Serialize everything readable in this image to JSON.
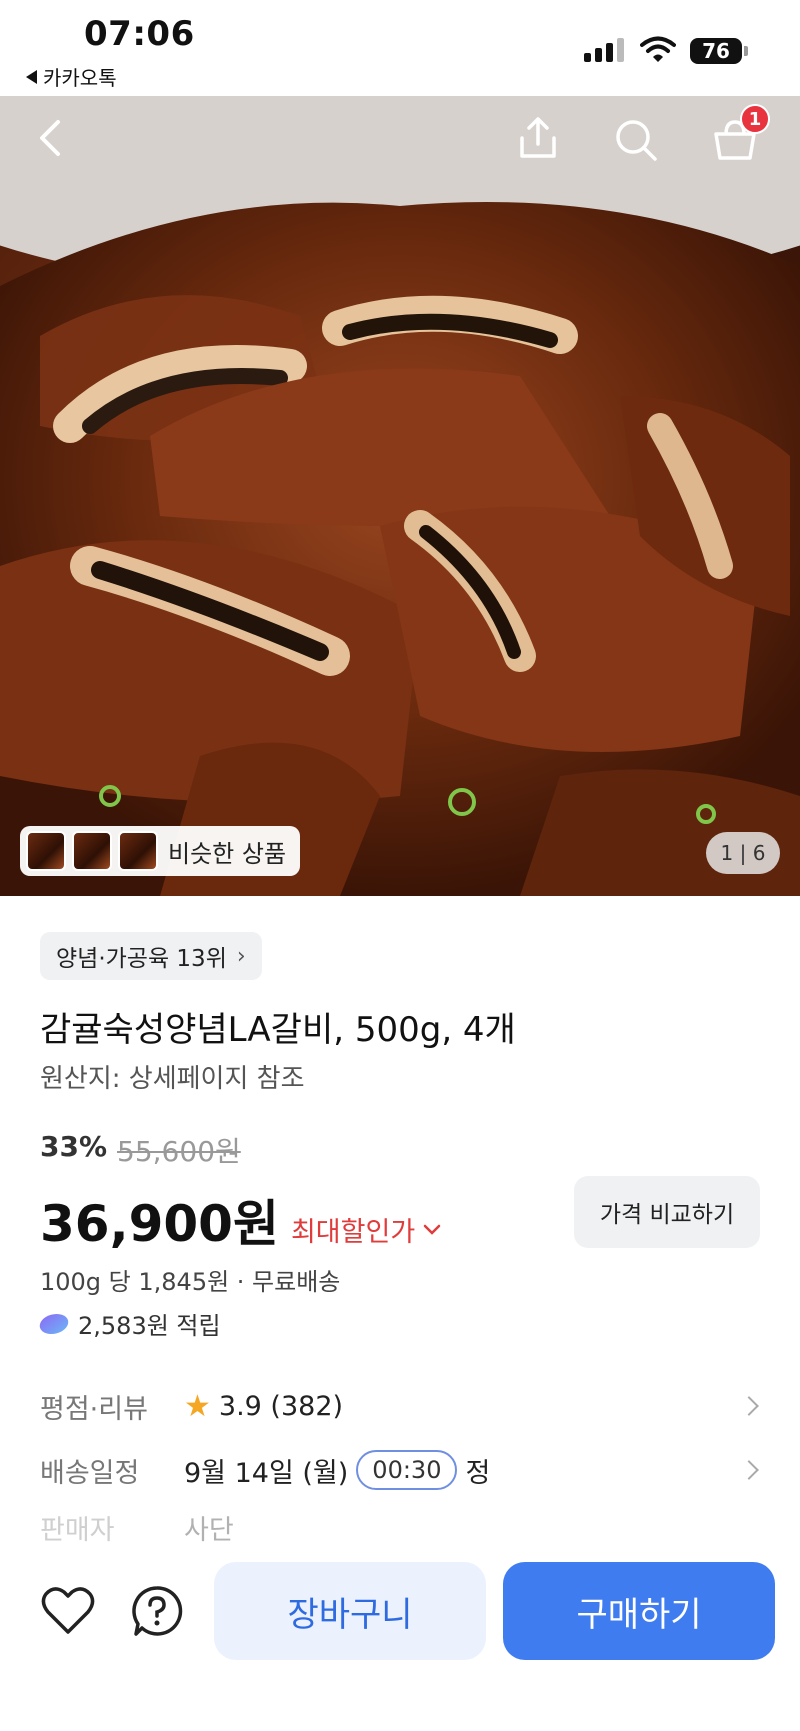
{
  "status_bar": {
    "time": "07:06",
    "back_app": "카카오톡",
    "battery": "76"
  },
  "hero": {
    "cart_count": "1",
    "similar_label": "비슷한 상품",
    "pager": "1 | 6"
  },
  "product": {
    "rank": "양념·가공육 13위",
    "title": "감귤숙성양념LA갈비, 500g, 4개",
    "origin": "원산지: 상세페이지 참조",
    "discount_pct": "33%",
    "original_price": "55,600원",
    "price": "36,900원",
    "max_discount_label": "최대할인가",
    "compare_label": "가격 비교하기",
    "unit_price": "100g 당 1,845원 · 무료배송",
    "points": "2,583원 적립"
  },
  "info": {
    "rating_label": "평점·리뷰",
    "rating_value": "3.9 (382)",
    "shipping_label": "배송일정",
    "shipping_value": "9월 14일 (월)",
    "shipping_time": "00:30",
    "shipping_suffix": "정",
    "seller_label": "판매자",
    "seller_value": "사단"
  },
  "bottom": {
    "cart_label": "장바구니",
    "buy_label": "구매하기"
  },
  "colors": {
    "accent": "#3f7cf0",
    "discount_red": "#e03c3c",
    "badge_red": "#e8343f"
  }
}
